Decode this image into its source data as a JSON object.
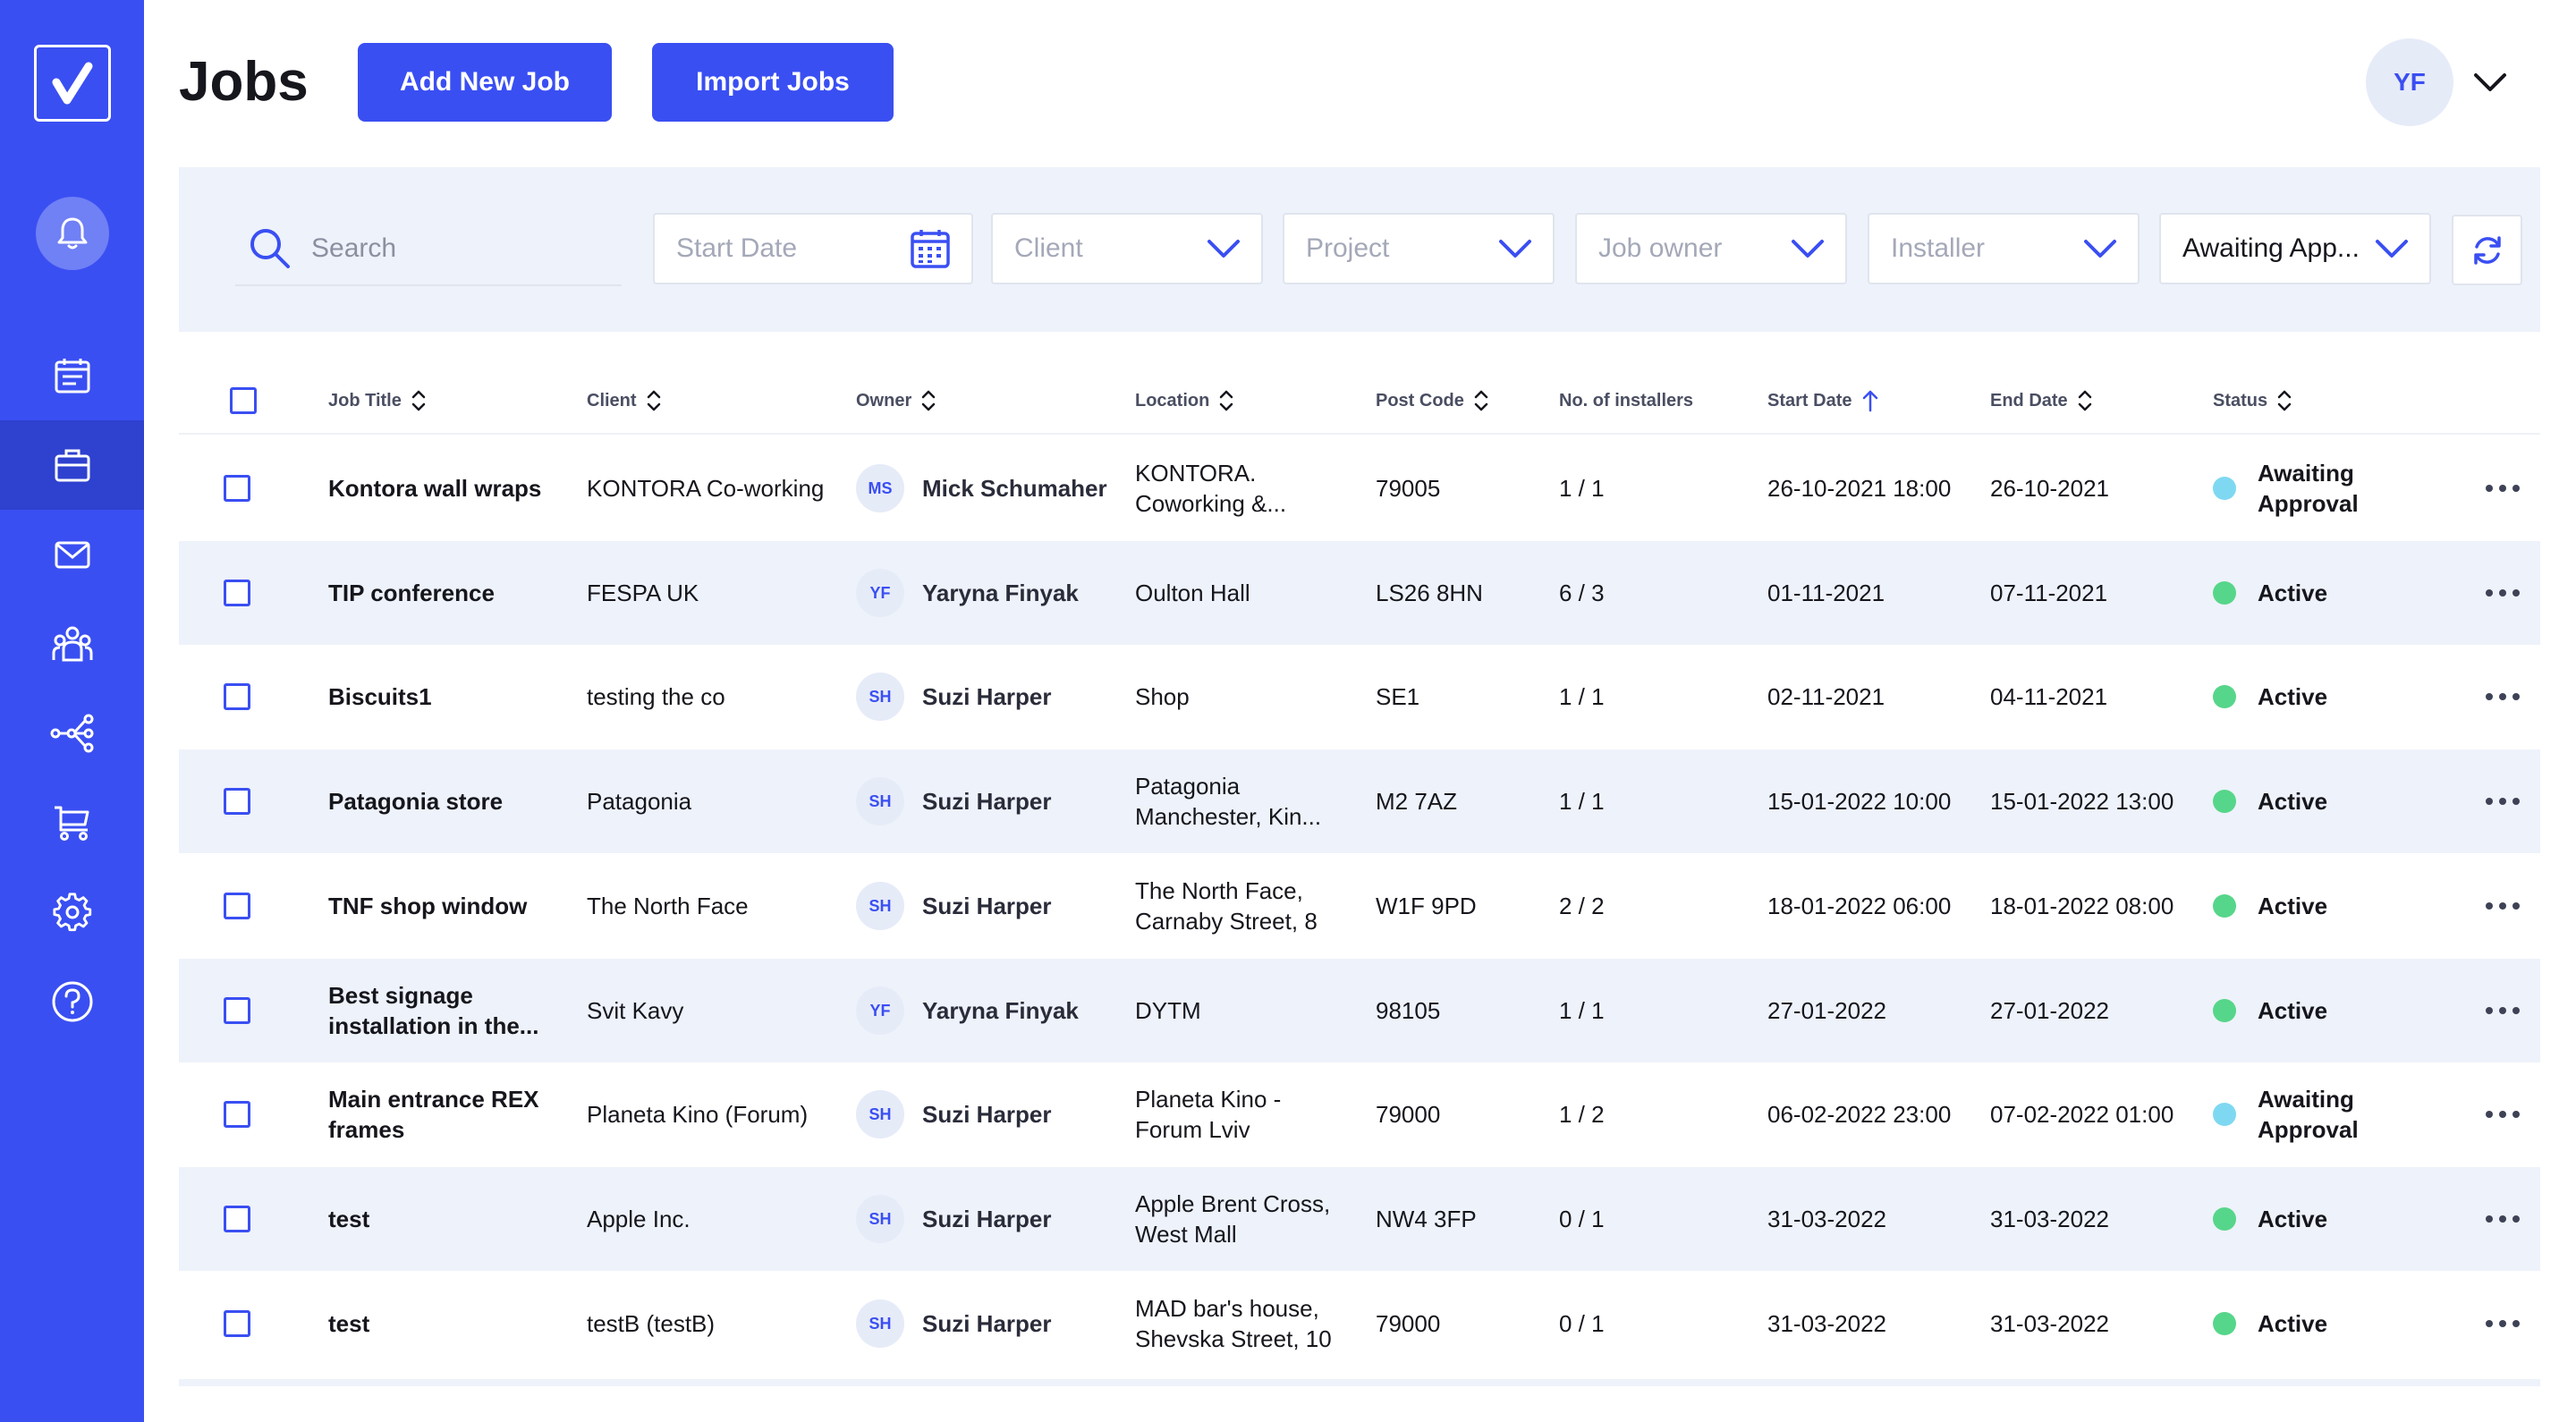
{
  "page": {
    "title": "Jobs"
  },
  "header": {
    "add_button": "Add New Job",
    "import_button": "Import Jobs",
    "user_initials": "YF"
  },
  "sidebar": {
    "items": [
      {
        "name": "bell",
        "icon": "bell-icon"
      },
      {
        "name": "calendar",
        "icon": "calendar-icon"
      },
      {
        "name": "jobs",
        "icon": "briefcase-icon",
        "active": true
      },
      {
        "name": "messages",
        "icon": "envelope-icon"
      },
      {
        "name": "team",
        "icon": "team-icon"
      },
      {
        "name": "workflow",
        "icon": "workflow-icon"
      },
      {
        "name": "shop",
        "icon": "cart-icon"
      },
      {
        "name": "settings",
        "icon": "gear-icon"
      },
      {
        "name": "help",
        "icon": "help-icon"
      }
    ]
  },
  "filters": {
    "search_placeholder": "Search",
    "start_date": "Start Date",
    "client": "Client",
    "project": "Project",
    "job_owner": "Job owner",
    "installer": "Installer",
    "status": "Awaiting App..."
  },
  "columns": {
    "job_title": "Job Title",
    "client": "Client",
    "owner": "Owner",
    "location": "Location",
    "post_code": "Post Code",
    "installers": "No. of installers",
    "start_date": "Start Date",
    "end_date": "End Date",
    "status": "Status"
  },
  "colors": {
    "accent": "#3a4ff2",
    "active": "#56d68a",
    "awaiting": "#7fd8f2"
  },
  "rows": [
    {
      "title": "Kontora wall wraps",
      "client": "KONTORA Co-working",
      "owner_initials": "MS",
      "owner": "Mick Schumaher",
      "location": "KONTORA. Coworking &...",
      "post_code": "79005",
      "installers": "1 / 1",
      "start": "26-10-2021 18:00",
      "end": "26-10-2021",
      "status": "Awaiting Approval",
      "status_key": "awaiting"
    },
    {
      "title": "TIP conference",
      "client": "FESPA UK",
      "owner_initials": "YF",
      "owner": "Yaryna Finyak",
      "location": "Oulton Hall",
      "post_code": "LS26 8HN",
      "installers": "6 / 3",
      "start": "01-11-2021",
      "end": "07-11-2021",
      "status": "Active",
      "status_key": "active"
    },
    {
      "title": "Biscuits1",
      "client": "testing the co",
      "owner_initials": "SH",
      "owner": "Suzi Harper",
      "location": "Shop",
      "post_code": "SE1",
      "installers": "1 / 1",
      "start": "02-11-2021",
      "end": "04-11-2021",
      "status": "Active",
      "status_key": "active"
    },
    {
      "title": "Patagonia store",
      "client": "Patagonia",
      "owner_initials": "SH",
      "owner": "Suzi Harper",
      "location": "Patagonia Manchester, Kin...",
      "post_code": "M2 7AZ",
      "installers": "1 / 1",
      "start": "15-01-2022 10:00",
      "end": "15-01-2022 13:00",
      "status": "Active",
      "status_key": "active"
    },
    {
      "title": "TNF shop window",
      "client": "The North Face",
      "owner_initials": "SH",
      "owner": "Suzi Harper",
      "location": "The North Face, Carnaby Street, 8",
      "post_code": "W1F 9PD",
      "installers": "2 / 2",
      "start": "18-01-2022 06:00",
      "end": "18-01-2022 08:00",
      "status": "Active",
      "status_key": "active"
    },
    {
      "title": "Best signage installation in the...",
      "client": "Svit Kavy",
      "owner_initials": "YF",
      "owner": "Yaryna Finyak",
      "location": "DYTM",
      "post_code": "98105",
      "installers": "1 / 1",
      "start": "27-01-2022",
      "end": "27-01-2022",
      "status": "Active",
      "status_key": "active"
    },
    {
      "title": "Main entrance REX frames",
      "client": "Planeta Kino (Forum)",
      "owner_initials": "SH",
      "owner": "Suzi Harper",
      "location": "Planeta Kino - Forum Lviv",
      "post_code": "79000",
      "installers": "1 / 2",
      "start": "06-02-2022 23:00",
      "end": "07-02-2022 01:00",
      "status": "Awaiting Approval",
      "status_key": "awaiting"
    },
    {
      "title": "test",
      "client": "Apple Inc.",
      "owner_initials": "SH",
      "owner": "Suzi Harper",
      "location": "Apple Brent Cross, West Mall",
      "post_code": "NW4 3FP",
      "installers": "0 / 1",
      "start": "31-03-2022",
      "end": "31-03-2022",
      "status": "Active",
      "status_key": "active"
    },
    {
      "title": "test",
      "client": "testB (testB)",
      "owner_initials": "SH",
      "owner": "Suzi Harper",
      "location": "MAD bar's house, Shevska Street, 10",
      "post_code": "79000",
      "installers": "0 / 1",
      "start": "31-03-2022",
      "end": "31-03-2022",
      "status": "Active",
      "status_key": "active"
    }
  ]
}
